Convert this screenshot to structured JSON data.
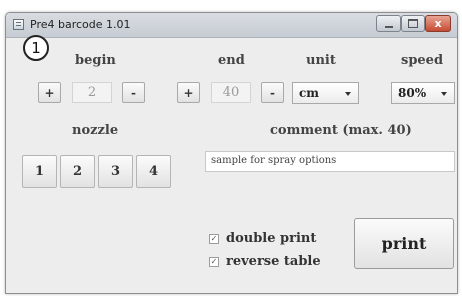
{
  "window": {
    "title": "Pre4 barcode 1.01",
    "controls": {
      "minimize": "minimize",
      "maximize": "maximize",
      "close": "x"
    }
  },
  "annotation": {
    "marker": "1"
  },
  "begin": {
    "label": "begin",
    "plus": "+",
    "minus": "-",
    "value": "2"
  },
  "end": {
    "label": "end",
    "plus": "+",
    "minus": "-",
    "value": "40"
  },
  "unit": {
    "label": "unit",
    "selected": "cm"
  },
  "speed": {
    "label": "speed",
    "selected": "80%"
  },
  "nozzle": {
    "label": "nozzle",
    "buttons": [
      "1",
      "2",
      "3",
      "4"
    ]
  },
  "comment": {
    "label": "comment (max. 40)",
    "value": "sample for spray options"
  },
  "options": {
    "double_print": {
      "label": "double print",
      "checked": true,
      "mark": "✓"
    },
    "reverse_table": {
      "label": "reverse table",
      "checked": true,
      "mark": "✓"
    }
  },
  "print": {
    "label": "print"
  }
}
